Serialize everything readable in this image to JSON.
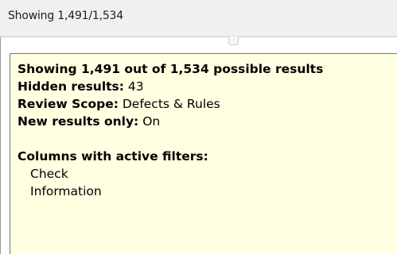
{
  "status_bar": {
    "text": "Showing 1,491/1,534"
  },
  "tooltip": {
    "heading": "Showing 1,491 out of 1,534 possible results",
    "hidden": {
      "label": "Hidden results:",
      "value": "43"
    },
    "scope": {
      "label": "Review Scope:",
      "value": "Defects & Rules"
    },
    "new_only": {
      "label": "New results only:",
      "value": "On"
    },
    "filters_heading": "Columns with active filters:",
    "filter_columns": [
      "Check",
      "Information"
    ]
  }
}
